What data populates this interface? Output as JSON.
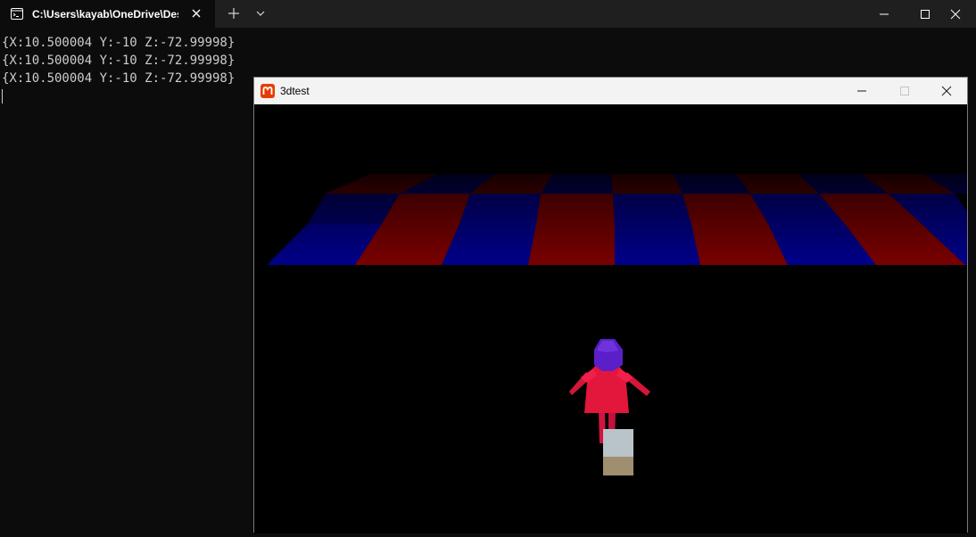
{
  "terminal": {
    "tab_title": "C:\\Users\\kayab\\OneDrive\\Des",
    "console_lines": [
      "{X:10.500004 Y:-10 Z:-72.99998}",
      "{X:10.500004 Y:-10 Z:-72.99998}",
      "{X:10.500004 Y:-10 Z:-72.99998}"
    ],
    "icons": {
      "tab": "terminal-icon",
      "close": "close-icon",
      "new_tab": "plus-icon",
      "dropdown": "chevron-down-icon",
      "minimize": "minimize-icon",
      "maximize": "maximize-icon",
      "window_close": "close-icon"
    }
  },
  "game_window": {
    "title": "3dtest",
    "icons": {
      "logo": "monogame-logo-icon",
      "minimize": "minimize-icon",
      "maximize": "maximize-icon",
      "close": "close-icon"
    },
    "colors": {
      "logo": "#e73c00",
      "floor_red": "#7a0000",
      "floor_blue": "#00008a",
      "character_body": "#e3163c",
      "character_hair": "#5a1fc8",
      "box_top": "#b9c4c9",
      "box_side": "#a08e70"
    }
  }
}
